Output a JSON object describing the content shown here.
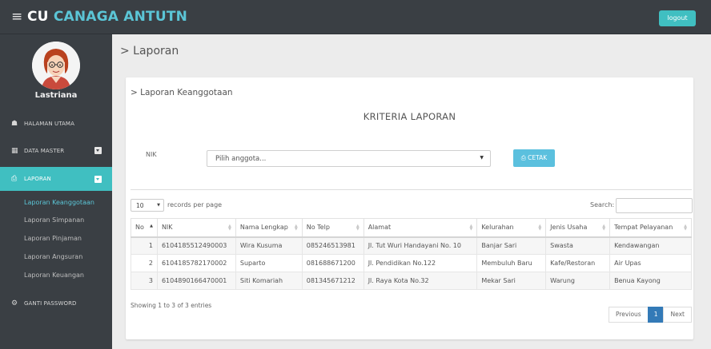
{
  "app": {
    "brand_prefix": "CU",
    "brand_rest": "CANAGA ANTUTN",
    "logout_label": "logout"
  },
  "sidebar": {
    "username": "Lastriana",
    "items": [
      {
        "label": "HALAMAN UTAMA",
        "icon": "home-icon"
      },
      {
        "label": "DATA MASTER",
        "icon": "folder-icon"
      },
      {
        "label": "LAPORAN",
        "icon": "print-icon"
      },
      {
        "label": "GANTI PASSWORD",
        "icon": "cogs-icon"
      }
    ],
    "submenu": [
      "Laporan Keanggotaan",
      "Laporan Simpanan",
      "Laporan Pinjaman",
      "Laporan Angsuran",
      "Laporan Keuangan"
    ]
  },
  "main": {
    "page_title": "> Laporan",
    "panel_title": "> Laporan Keanggotaan",
    "criteria_title": "KRITERIA LAPORAN",
    "nik_label": "NIK",
    "select_value": "Pilih anggota...",
    "cetak_label": "CETAK",
    "length_value": "10",
    "length_suffix": "records per page",
    "search_label": "Search:",
    "info_text": "Showing 1 to 3 of 3 entries",
    "pagination": {
      "previous": "Previous",
      "current": "1",
      "next": "Next"
    }
  },
  "table": {
    "columns": [
      "No",
      "NIK",
      "Nama Lengkap",
      "No Telp",
      "Alamat",
      "Kelurahan",
      "Jenis Usaha",
      "Tempat Pelayanan"
    ],
    "rows": [
      [
        "1",
        "6104185512490003",
        "Wira Kusuma",
        "085246513981",
        "Jl. Tut Wuri Handayani No. 10",
        "Banjar Sari",
        "Swasta",
        "Kendawangan"
      ],
      [
        "2",
        "6104185782170002",
        "Suparto",
        "081688671200",
        "Jl. Pendidikan No.122",
        "Membuluh Baru",
        "Kafe/Restoran",
        "Air Upas"
      ],
      [
        "3",
        "6104890166470001",
        "Siti Komariah",
        "081345671212",
        "Jl. Raya Kota No.32",
        "Mekar Sari",
        "Warung",
        "Benua Kayong"
      ]
    ]
  }
}
